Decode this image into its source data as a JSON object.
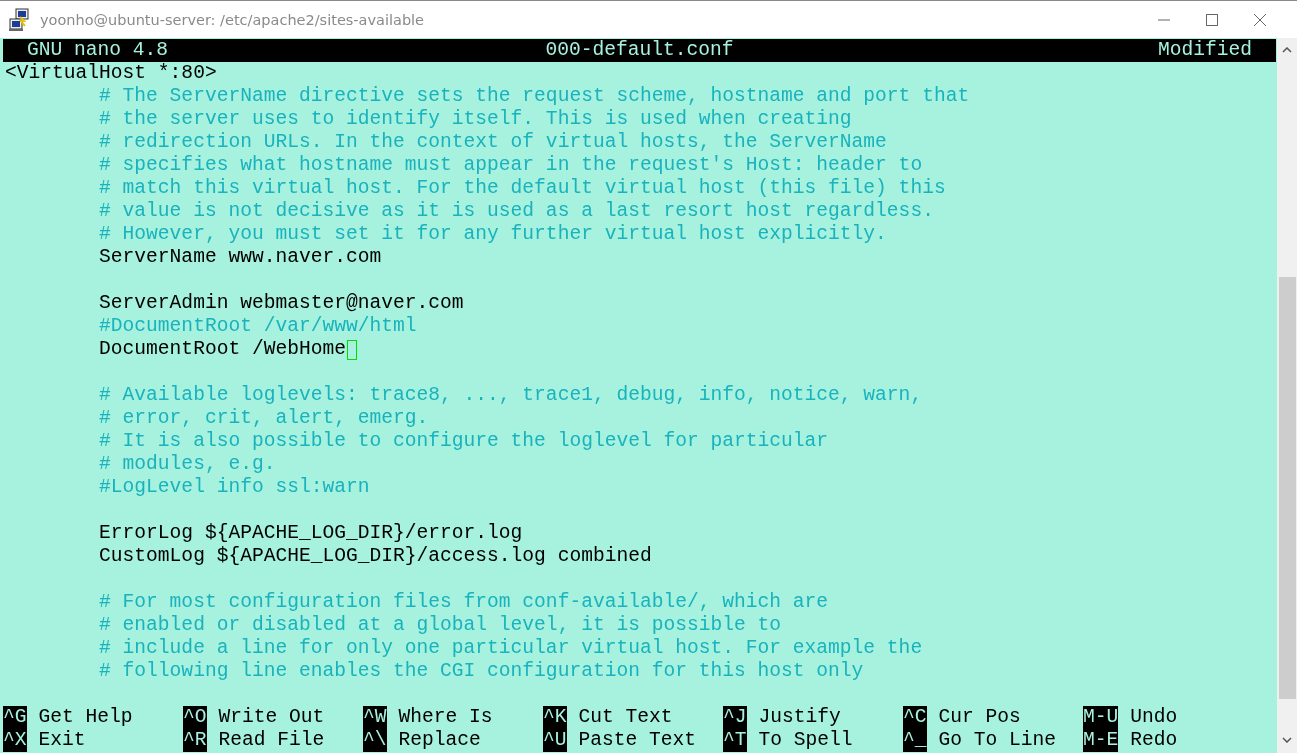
{
  "window": {
    "title": "yoonho@ubuntu-server: /etc/apache2/sites-available"
  },
  "editor": {
    "app": "GNU nano 4.8",
    "filename": "000-default.conf",
    "status": "Modified",
    "lines": [
      {
        "kind": "code",
        "text": "<VirtualHost *:80>",
        "children": [
          {
            "kind": "comment",
            "text": "# The ServerName directive sets the request scheme, hostname and port that"
          },
          {
            "kind": "comment",
            "text": "# the server uses to identify itself. This is used when creating"
          },
          {
            "kind": "comment",
            "text": "# redirection URLs. In the context of virtual hosts, the ServerName"
          },
          {
            "kind": "comment",
            "text": "# specifies what hostname must appear in the request's Host: header to"
          },
          {
            "kind": "comment",
            "text": "# match this virtual host. For the default virtual host (this file) this"
          },
          {
            "kind": "comment",
            "text": "# value is not decisive as it is used as a last resort host regardless."
          },
          {
            "kind": "comment",
            "text": "# However, you must set it for any further virtual host explicitly."
          },
          {
            "kind": "code",
            "text": "ServerName www.naver.com"
          },
          {
            "kind": "blank"
          },
          {
            "kind": "code",
            "text": "ServerAdmin webmaster@naver.com"
          },
          {
            "kind": "comment",
            "text": "#DocumentRoot /var/www/html"
          },
          {
            "kind": "code",
            "text": "DocumentRoot /WebHome",
            "cursor": true
          },
          {
            "kind": "blank"
          },
          {
            "kind": "comment",
            "text": "# Available loglevels: trace8, ..., trace1, debug, info, notice, warn,"
          },
          {
            "kind": "comment",
            "text": "# error, crit, alert, emerg."
          },
          {
            "kind": "comment",
            "text": "# It is also possible to configure the loglevel for particular"
          },
          {
            "kind": "comment",
            "text": "# modules, e.g."
          },
          {
            "kind": "comment",
            "text": "#LogLevel info ssl:warn"
          },
          {
            "kind": "blank"
          },
          {
            "kind": "code",
            "text": "ErrorLog ${APACHE_LOG_DIR}/error.log"
          },
          {
            "kind": "code",
            "text": "CustomLog ${APACHE_LOG_DIR}/access.log combined"
          },
          {
            "kind": "blank"
          },
          {
            "kind": "comment",
            "text": "# For most configuration files from conf-available/, which are"
          },
          {
            "kind": "comment",
            "text": "# enabled or disabled at a global level, it is possible to"
          },
          {
            "kind": "comment",
            "text": "# include a line for only one particular virtual host. For example the"
          },
          {
            "kind": "comment",
            "text": "# following line enables the CGI configuration for this host only"
          }
        ]
      }
    ],
    "shortcut_rows": [
      [
        {
          "key": "^G",
          "label": "Get Help"
        },
        {
          "key": "^O",
          "label": "Write Out"
        },
        {
          "key": "^W",
          "label": "Where Is"
        },
        {
          "key": "^K",
          "label": "Cut Text"
        },
        {
          "key": "^J",
          "label": "Justify"
        },
        {
          "key": "^C",
          "label": "Cur Pos"
        },
        {
          "key": "M-U",
          "label": "Undo"
        }
      ],
      [
        {
          "key": "^X",
          "label": "Exit"
        },
        {
          "key": "^R",
          "label": "Read File"
        },
        {
          "key": "^\\",
          "label": "Replace"
        },
        {
          "key": "^U",
          "label": "Paste Text"
        },
        {
          "key": "^T",
          "label": "To Spell"
        },
        {
          "key": "^_",
          "label": "Go To Line"
        },
        {
          "key": "M-E",
          "label": "Redo"
        }
      ]
    ]
  }
}
